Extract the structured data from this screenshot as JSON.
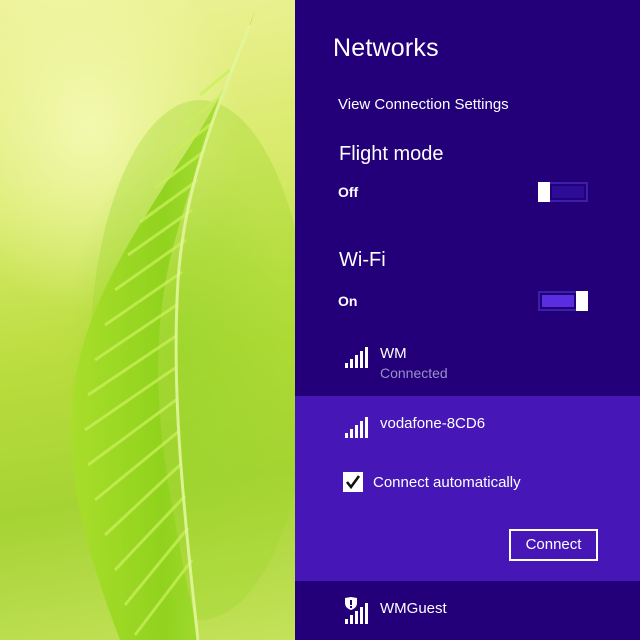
{
  "panel": {
    "title": "Networks",
    "view_settings_link": "View Connection Settings"
  },
  "flight_mode": {
    "heading": "Flight mode",
    "state_label": "Off",
    "enabled": false
  },
  "wifi": {
    "heading": "Wi-Fi",
    "state_label": "On",
    "enabled": true
  },
  "networks": [
    {
      "name": "WM",
      "status": "Connected",
      "icon": "wifi-signal-icon"
    },
    {
      "name": "vodafone-8CD6",
      "status": "",
      "icon": "wifi-signal-icon",
      "selected": true
    },
    {
      "name": "WMGuest",
      "status": "",
      "icon": "wifi-unsecured-icon"
    }
  ],
  "selected_network": {
    "connect_automatically_label": "Connect automatically",
    "connect_automatically_checked": true,
    "connect_button_label": "Connect"
  },
  "colors": {
    "panel_background": "#23007a",
    "selected_background": "#4617b6",
    "toggle_on_track": "#5a2ee0",
    "text": "#ffffff",
    "muted_text": "#9a8fc8"
  }
}
